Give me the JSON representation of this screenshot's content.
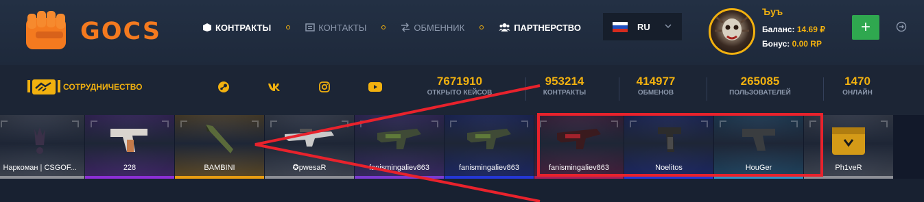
{
  "brand": {
    "name": "GOCS",
    "logo_icon": "fist-icon"
  },
  "nav": {
    "contracts": {
      "label": "КОНТРАКТЫ",
      "icon": "box-icon"
    },
    "contacts": {
      "label": "КОНТАКТЫ",
      "icon": "list-icon"
    },
    "exchanger": {
      "label": "ОБМЕННИК",
      "icon": "exchange-icon"
    },
    "partnership": {
      "label": "ПАРТНЕРСТВО",
      "icon": "users-icon"
    }
  },
  "language": {
    "code": "RU",
    "flag": [
      "#ffffff",
      "#1f4fbf",
      "#d52b1e"
    ]
  },
  "user": {
    "name": "Ъуъ",
    "balance_label": "Баланс:",
    "balance_value": "14.69 ₽",
    "bonus_label": "Бонус:",
    "bonus_value": "0.00 RP",
    "add_label": "+"
  },
  "partner_link": {
    "label": "СОТРУДНИЧЕСТВО",
    "icon": "handshake-icon"
  },
  "socials": [
    "steam-icon",
    "vk-icon",
    "instagram-icon",
    "youtube-icon"
  ],
  "stats": [
    {
      "value": "7671910",
      "label": "ОТКРЫТО КЕЙСОВ"
    },
    {
      "value": "953214",
      "label": "КОНТРАКТЫ"
    },
    {
      "value": "414977",
      "label": "ОБМЕНОВ"
    },
    {
      "value": "265085",
      "label": "ПОЛЬЗОВАТЕЛЕЙ"
    },
    {
      "value": "1470",
      "label": "ОНЛАЙН"
    }
  ],
  "drops": [
    {
      "user": "Наркоман | CSGOF...",
      "rarity": "#8d8f96",
      "item": "crown-icon"
    },
    {
      "user": "228",
      "rarity": "#8c2fd6",
      "item": "pistol-icon"
    },
    {
      "user": "BAMBINI",
      "rarity": "#e89d12",
      "item": "knife-icon"
    },
    {
      "user": "✪pwesaR",
      "rarity": "#8d8f96",
      "item": "rifle-icon"
    },
    {
      "user": "fanismingaliev863",
      "rarity": "#7b3bd1",
      "item": "smg-icon"
    },
    {
      "user": "fanismingaliev863",
      "rarity": "#2437d6",
      "item": "smg-icon"
    },
    {
      "user": "fanismingaliev863",
      "rarity": "#a8205a",
      "item": "smg-icon"
    },
    {
      "user": "Noelitos",
      "rarity": "#2437d6",
      "item": "machine-pistol-icon"
    },
    {
      "user": "HouGer",
      "rarity": "#2e92c8",
      "item": "pistol-icon"
    },
    {
      "user": "Ph1veR",
      "rarity": "#8d8f96",
      "item": "case-icon"
    }
  ],
  "annotation_color": "#e8222c"
}
